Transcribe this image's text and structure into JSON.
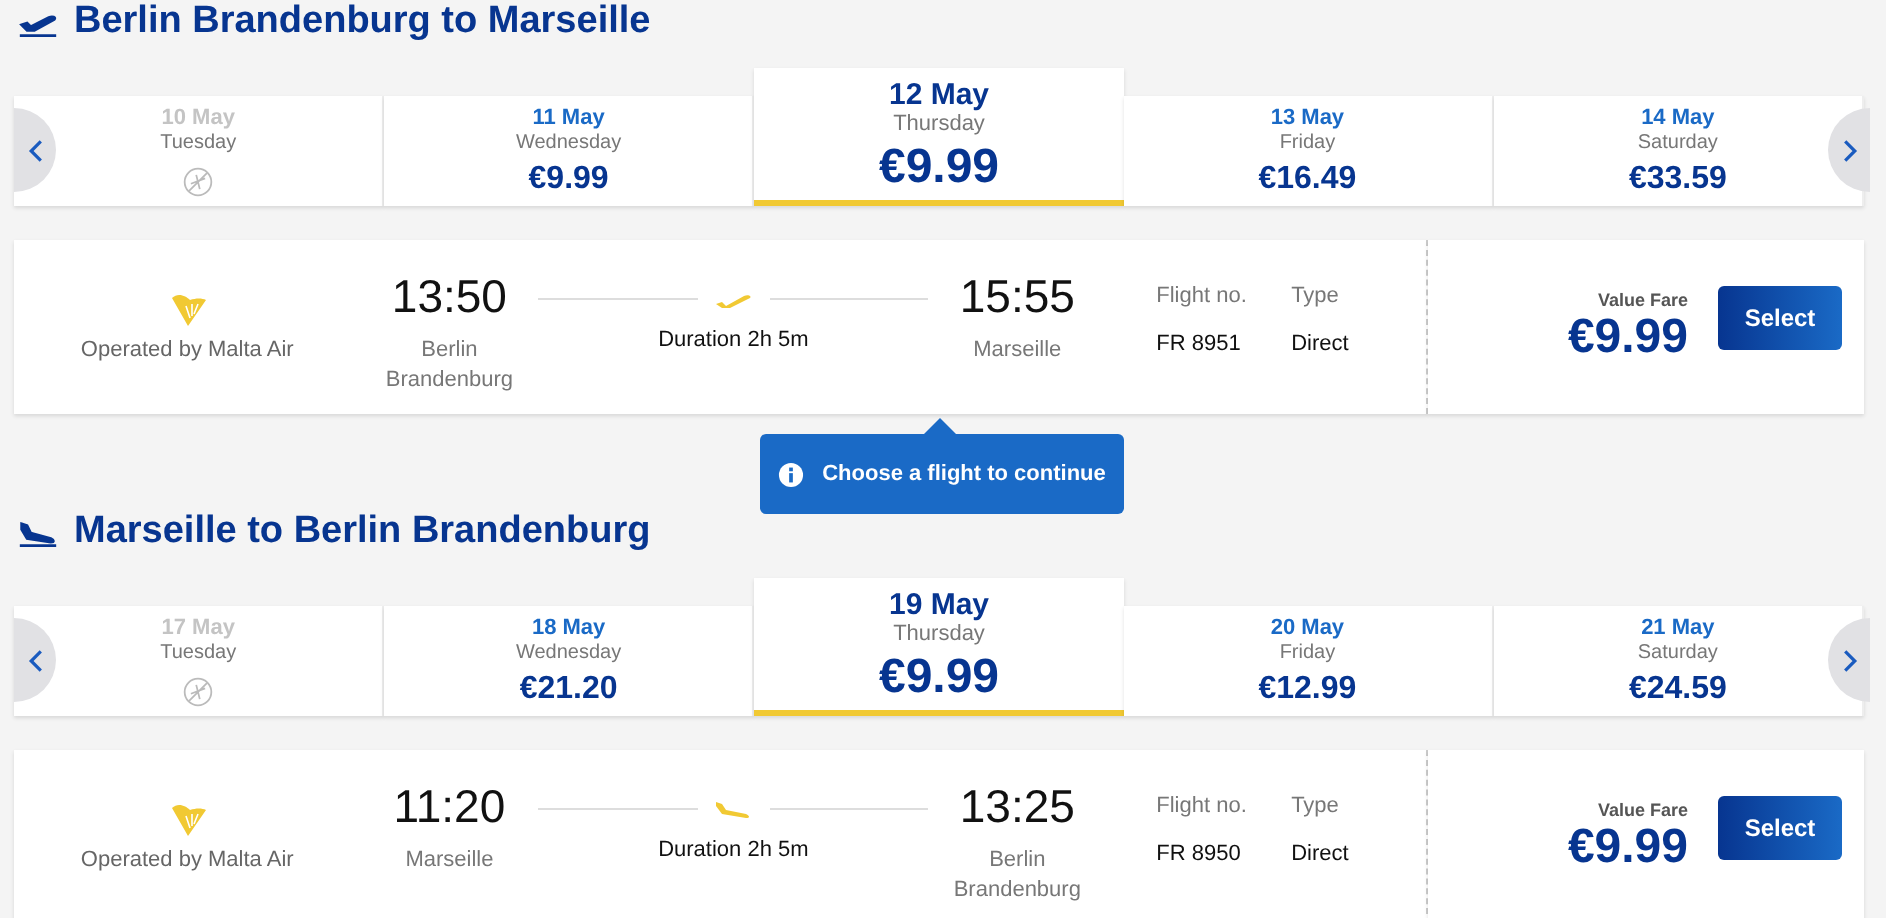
{
  "sections": [
    {
      "kind": "outbound",
      "title": "Berlin Brandenburg to Marseille",
      "dates": [
        {
          "date": "10 May",
          "weekday": "Tuesday",
          "available": false,
          "selected": false
        },
        {
          "date": "11 May",
          "weekday": "Wednesday",
          "price": "€9.99",
          "available": true,
          "selected": false
        },
        {
          "date": "12 May",
          "weekday": "Thursday",
          "price": "€9.99",
          "available": true,
          "selected": true
        },
        {
          "date": "13 May",
          "weekday": "Friday",
          "price": "€16.49",
          "available": true,
          "selected": false
        },
        {
          "date": "14 May",
          "weekday": "Saturday",
          "price": "€33.59",
          "available": true,
          "selected": false
        }
      ],
      "flight": {
        "operator": "Operated by Malta Air",
        "depart_time": "13:50",
        "depart_airport": "Berlin Brandenburg",
        "duration": "Duration 2h 5m",
        "arrive_time": "15:55",
        "arrive_airport": "Marseille",
        "flight_no_label": "Flight no.",
        "flight_no": "FR 8951",
        "type_label": "Type",
        "type": "Direct",
        "fare_label": "Value Fare",
        "price": "€9.99",
        "button": "Select"
      }
    },
    {
      "kind": "return",
      "title": "Marseille to Berlin Brandenburg",
      "dates": [
        {
          "date": "17 May",
          "weekday": "Tuesday",
          "available": false,
          "selected": false
        },
        {
          "date": "18 May",
          "weekday": "Wednesday",
          "price": "€21.20",
          "available": true,
          "selected": false
        },
        {
          "date": "19 May",
          "weekday": "Thursday",
          "price": "€9.99",
          "available": true,
          "selected": true
        },
        {
          "date": "20 May",
          "weekday": "Friday",
          "price": "€12.99",
          "available": true,
          "selected": false
        },
        {
          "date": "21 May",
          "weekday": "Saturday",
          "price": "€24.59",
          "available": true,
          "selected": false
        }
      ],
      "flight": {
        "operator": "Operated by Malta Air",
        "depart_time": "11:20",
        "depart_airport": "Marseille",
        "duration": "Duration 2h 5m",
        "arrive_time": "13:25",
        "arrive_airport": "Berlin Brandenburg",
        "flight_no_label": "Flight no.",
        "flight_no": "FR 8950",
        "type_label": "Type",
        "type": "Direct",
        "fare_label": "Value Fare",
        "price": "€9.99",
        "button": "Select"
      }
    }
  ],
  "notice": {
    "text": "Choose a flight to continue"
  }
}
